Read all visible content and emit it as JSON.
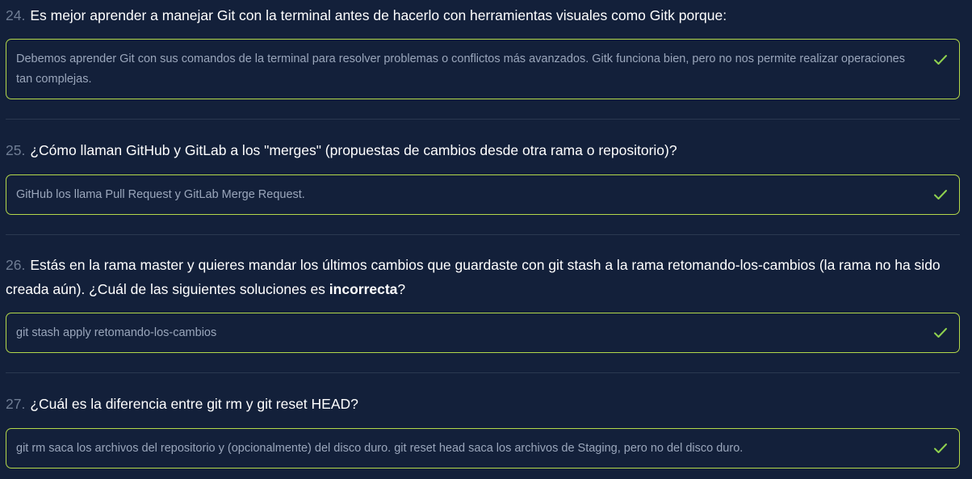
{
  "questions": [
    {
      "number": "24.",
      "text": "Es mejor aprender a manejar Git con la terminal antes de hacerlo con herramientas visuales como Gitk porque:",
      "answer": "Debemos aprender Git con sus comandos de la terminal para resolver problemas o conflictos más avanzados. Gitk funciona bien, pero no nos permite realizar operaciones tan complejas.",
      "status_icon": "check-icon"
    },
    {
      "number": "25.",
      "text": "¿Cómo llaman GitHub y GitLab a los \"merges\" (propuestas de cambios desde otra rama o repositorio)?",
      "answer": "GitHub los llama Pull Request y GitLab Merge Request.",
      "status_icon": "check-icon"
    },
    {
      "number": "26.",
      "text_before": "Estás en la rama master y quieres mandar los últimos cambios que guardaste con git stash a la rama retomando-los-cambios (la rama no ha sido creada aún). ¿Cuál de las siguientes soluciones es ",
      "text_bold": "incorrecta",
      "text_after": "?",
      "answer": "git stash apply retomando-los-cambios",
      "status_icon": "check-icon"
    },
    {
      "number": "27.",
      "text": "¿Cuál es la diferencia entre git rm y git reset HEAD?",
      "answer": "git rm saca los archivos del repositorio y (opcionalmente) del disco duro. git reset head saca los archivos de Staging, pero no del disco duro.",
      "status_icon": "check-icon"
    }
  ],
  "colors": {
    "background": "#13203a",
    "border_correct": "#b4d84a",
    "check": "#8fd14f",
    "answer_text": "#9aa6bb",
    "number": "#6f7d94"
  }
}
